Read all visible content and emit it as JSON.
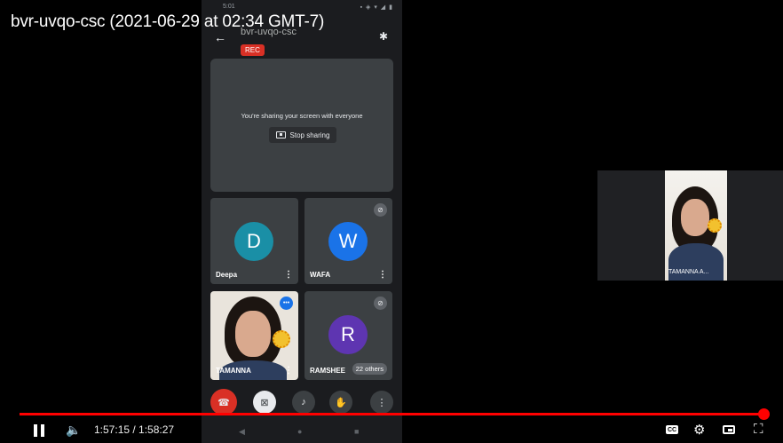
{
  "video": {
    "title": "bvr-uvqo-csc (2021-06-29 at 02:34 GMT-7)"
  },
  "phone": {
    "status_time": "5:01",
    "header": {
      "meeting_code": "bvr-uvqo-csc",
      "rec_label": "REC"
    },
    "share_panel": {
      "message": "You're sharing your screen with everyone",
      "stop_label": "Stop sharing"
    },
    "participants": [
      {
        "name": "Deepa",
        "initial": "D",
        "color": "#1a8fa6"
      },
      {
        "name": "WAFA",
        "initial": "W",
        "color": "#1a73e8"
      },
      {
        "name": "TAMANNA"
      },
      {
        "name": "RAMSHEE",
        "initial": "R",
        "color": "#5e35b1",
        "others": "22 others"
      }
    ]
  },
  "self_view": {
    "name": "TAMANNA A..."
  },
  "player": {
    "time": "1:57:15 / 1:58:27",
    "progress": 0.99,
    "accent": "#ff0000"
  }
}
